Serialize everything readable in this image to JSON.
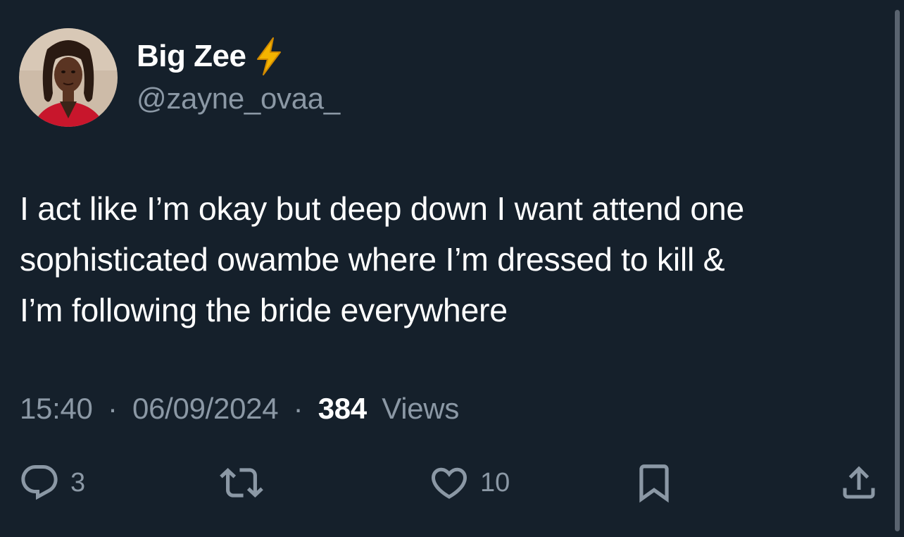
{
  "author": {
    "display_name": "Big Zee",
    "badge_emoji": "⚡",
    "handle": "@zayne_ovaa_"
  },
  "tweet": {
    "lines": [
      "I act like I’m okay but deep down I want attend one",
      "sophisticated owambe where I’m dressed to kill &",
      "I’m following the bride everywhere"
    ],
    "time": "15:40",
    "date": "06/09/2024",
    "separator": "·",
    "views_count": "384",
    "views_label": "Views"
  },
  "actions": {
    "reply_count": "3",
    "like_count": "10"
  },
  "colors": {
    "background": "#15202b",
    "text_primary": "#ffffff",
    "text_secondary": "#8b98a5",
    "bolt": "#f4b400"
  },
  "icons": [
    "reply-icon",
    "retweet-icon",
    "like-icon",
    "bookmark-icon",
    "share-icon",
    "lightning-bolt-icon"
  ]
}
